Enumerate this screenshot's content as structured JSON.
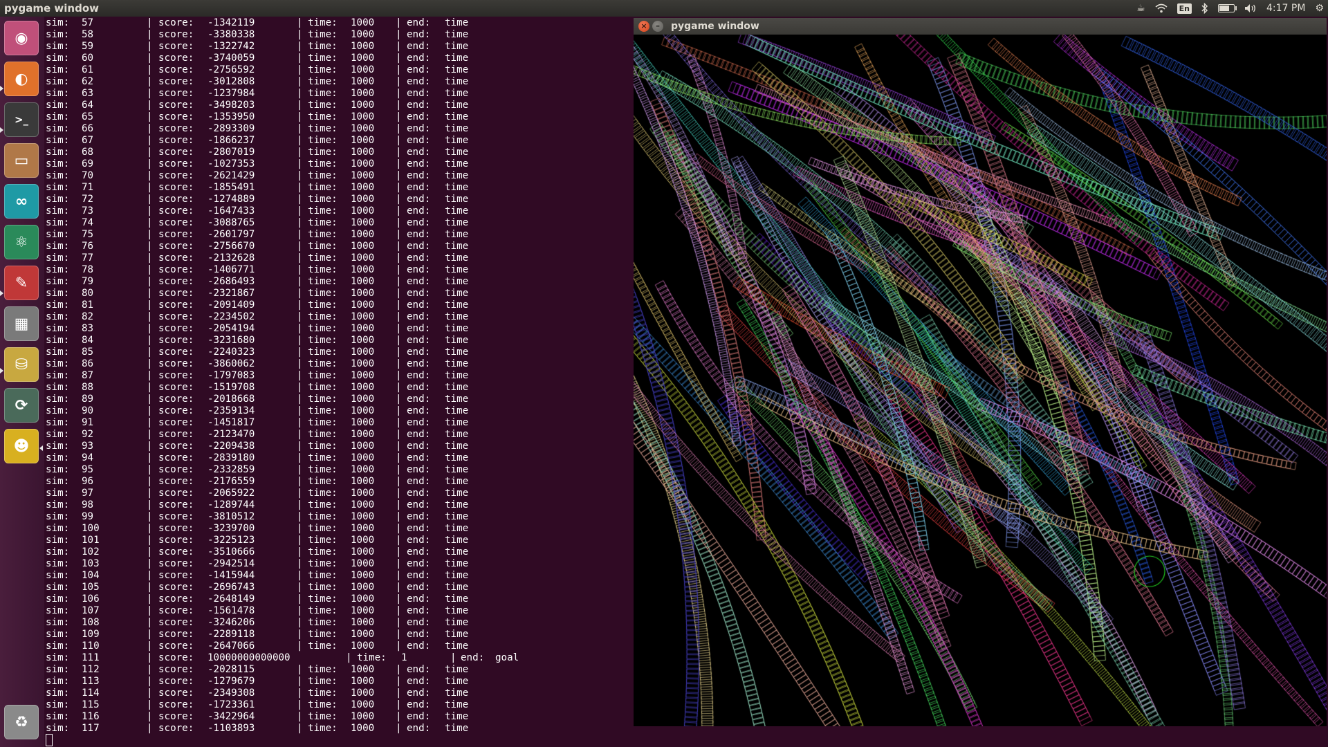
{
  "top_panel": {
    "title": "pygame window",
    "keyboard": "En",
    "battery_level": 0.75,
    "clock": "4:17 PM"
  },
  "launcher": {
    "items": [
      {
        "name": "ubuntu-dash",
        "icon": "ubuntu-logo-icon",
        "color": "#c0507a"
      },
      {
        "name": "firefox",
        "icon": "firefox-icon",
        "color": "#e0712b"
      },
      {
        "name": "terminal",
        "icon": "terminal-icon",
        "color": "#3a3a3a"
      },
      {
        "name": "files",
        "icon": "file-cabinet-icon",
        "color": "#b07848"
      },
      {
        "name": "arduino",
        "icon": "infinity-icon",
        "color": "#1f9aa5"
      },
      {
        "name": "atom",
        "icon": "atom-icon",
        "color": "#2a8a5a"
      },
      {
        "name": "system-tools",
        "icon": "wrench-icon",
        "color": "#c03838"
      },
      {
        "name": "workspace-switcher",
        "icon": "workspaces-icon",
        "color": "#7a7a7a"
      },
      {
        "name": "database",
        "icon": "database-icon",
        "color": "#c8a840"
      },
      {
        "name": "software-updater",
        "icon": "updater-icon",
        "color": "#4a6a5a"
      },
      {
        "name": "bug-tool",
        "icon": "bug-icon",
        "color": "#d8b020"
      },
      {
        "name": "trash",
        "icon": "trash-icon",
        "color": "#8a8a8a"
      }
    ]
  },
  "terminal": {
    "lines": [
      {
        "sim": "57",
        "score": "-1342119",
        "time": "1000",
        "end": "time"
      },
      {
        "sim": "58",
        "score": "-3380338",
        "time": "1000",
        "end": "time"
      },
      {
        "sim": "59",
        "score": "-1322742",
        "time": "1000",
        "end": "time"
      },
      {
        "sim": "60",
        "score": "-3740059",
        "time": "1000",
        "end": "time"
      },
      {
        "sim": "61",
        "score": "-2756592",
        "time": "1000",
        "end": "time"
      },
      {
        "sim": "62",
        "score": "-3012808",
        "time": "1000",
        "end": "time"
      },
      {
        "sim": "63",
        "score": "-1237984",
        "time": "1000",
        "end": "time"
      },
      {
        "sim": "64",
        "score": "-3498203",
        "time": "1000",
        "end": "time"
      },
      {
        "sim": "65",
        "score": "-1353950",
        "time": "1000",
        "end": "time"
      },
      {
        "sim": "66",
        "score": "-2893309",
        "time": "1000",
        "end": "time"
      },
      {
        "sim": "67",
        "score": "-1866237",
        "time": "1000",
        "end": "time"
      },
      {
        "sim": "68",
        "score": "-2807019",
        "time": "1000",
        "end": "time"
      },
      {
        "sim": "69",
        "score": "-1027353",
        "time": "1000",
        "end": "time"
      },
      {
        "sim": "70",
        "score": "-2621429",
        "time": "1000",
        "end": "time"
      },
      {
        "sim": "71",
        "score": "-1855491",
        "time": "1000",
        "end": "time"
      },
      {
        "sim": "72",
        "score": "-1274889",
        "time": "1000",
        "end": "time"
      },
      {
        "sim": "73",
        "score": "-1647433",
        "time": "1000",
        "end": "time"
      },
      {
        "sim": "74",
        "score": "-3088765",
        "time": "1000",
        "end": "time"
      },
      {
        "sim": "75",
        "score": "-2601797",
        "time": "1000",
        "end": "time"
      },
      {
        "sim": "76",
        "score": "-2756670",
        "time": "1000",
        "end": "time"
      },
      {
        "sim": "77",
        "score": "-2132628",
        "time": "1000",
        "end": "time"
      },
      {
        "sim": "78",
        "score": "-1406771",
        "time": "1000",
        "end": "time"
      },
      {
        "sim": "79",
        "score": "-2686493",
        "time": "1000",
        "end": "time"
      },
      {
        "sim": "80",
        "score": "-2321867",
        "time": "1000",
        "end": "time"
      },
      {
        "sim": "81",
        "score": "-2091409",
        "time": "1000",
        "end": "time"
      },
      {
        "sim": "82",
        "score": "-2234502",
        "time": "1000",
        "end": "time"
      },
      {
        "sim": "83",
        "score": "-2054194",
        "time": "1000",
        "end": "time"
      },
      {
        "sim": "84",
        "score": "-3231680",
        "time": "1000",
        "end": "time"
      },
      {
        "sim": "85",
        "score": "-2240323",
        "time": "1000",
        "end": "time"
      },
      {
        "sim": "86",
        "score": "-3860062",
        "time": "1000",
        "end": "time"
      },
      {
        "sim": "87",
        "score": "-1797083",
        "time": "1000",
        "end": "time"
      },
      {
        "sim": "88",
        "score": "-1519708",
        "time": "1000",
        "end": "time"
      },
      {
        "sim": "89",
        "score": "-2018668",
        "time": "1000",
        "end": "time"
      },
      {
        "sim": "90",
        "score": "-2359134",
        "time": "1000",
        "end": "time"
      },
      {
        "sim": "91",
        "score": "-1451817",
        "time": "1000",
        "end": "time"
      },
      {
        "sim": "92",
        "score": "-2123470",
        "time": "1000",
        "end": "time"
      },
      {
        "sim": "93",
        "score": "-2209438",
        "time": "1000",
        "end": "time"
      },
      {
        "sim": "94",
        "score": "-2839180",
        "time": "1000",
        "end": "time"
      },
      {
        "sim": "95",
        "score": "-2332859",
        "time": "1000",
        "end": "time"
      },
      {
        "sim": "96",
        "score": "-2176559",
        "time": "1000",
        "end": "time"
      },
      {
        "sim": "97",
        "score": "-2065922",
        "time": "1000",
        "end": "time"
      },
      {
        "sim": "98",
        "score": "-1289744",
        "time": "1000",
        "end": "time"
      },
      {
        "sim": "99",
        "score": "-3810512",
        "time": "1000",
        "end": "time"
      },
      {
        "sim": "100",
        "score": "-3239700",
        "time": "1000",
        "end": "time"
      },
      {
        "sim": "101",
        "score": "-3225123",
        "time": "1000",
        "end": "time"
      },
      {
        "sim": "102",
        "score": "-3510666",
        "time": "1000",
        "end": "time"
      },
      {
        "sim": "103",
        "score": "-2942514",
        "time": "1000",
        "end": "time"
      },
      {
        "sim": "104",
        "score": "-1415944",
        "time": "1000",
        "end": "time"
      },
      {
        "sim": "105",
        "score": "-2696743",
        "time": "1000",
        "end": "time"
      },
      {
        "sim": "106",
        "score": "-2648149",
        "time": "1000",
        "end": "time"
      },
      {
        "sim": "107",
        "score": "-1561478",
        "time": "1000",
        "end": "time"
      },
      {
        "sim": "108",
        "score": "-3246206",
        "time": "1000",
        "end": "time"
      },
      {
        "sim": "109",
        "score": "-2289118",
        "time": "1000",
        "end": "time"
      },
      {
        "sim": "110",
        "score": "-2647066",
        "time": "1000",
        "end": "time"
      },
      {
        "sim": "111",
        "score": "10000000000000",
        "time": "1",
        "end": "goal"
      },
      {
        "sim": "112",
        "score": "-2028115",
        "time": "1000",
        "end": "time"
      },
      {
        "sim": "113",
        "score": "-1279679",
        "time": "1000",
        "end": "time"
      },
      {
        "sim": "114",
        "score": "-2349308",
        "time": "1000",
        "end": "time"
      },
      {
        "sim": "115",
        "score": "-1723361",
        "time": "1000",
        "end": "time"
      },
      {
        "sim": "116",
        "score": "-3422964",
        "time": "1000",
        "end": "time"
      },
      {
        "sim": "117",
        "score": "-1103893",
        "time": "1000",
        "end": "time"
      }
    ],
    "sim_label": "sim:",
    "score_label": "score:",
    "time_label": "time:",
    "end_label": "end:",
    "separator": "|"
  },
  "pygame_window": {
    "title": "pygame window",
    "close_glyph": "×",
    "minimize_glyph": "–"
  }
}
